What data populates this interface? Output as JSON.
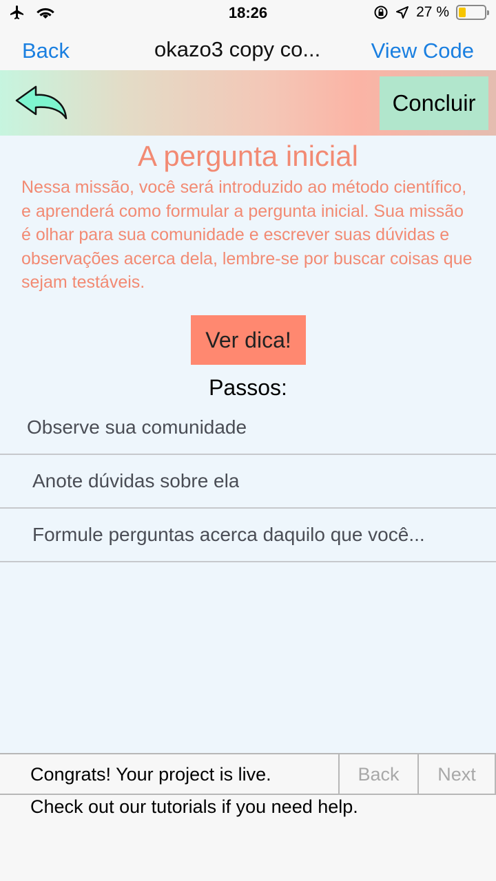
{
  "status_bar": {
    "time": "18:26",
    "battery_percent": "27 %",
    "battery_level": 0.27,
    "icons": [
      "airplane-icon",
      "wifi-icon",
      "rotation-lock-icon",
      "location-icon",
      "battery-icon"
    ]
  },
  "nav": {
    "back_label": "Back",
    "title": "okazo3 copy co...",
    "view_code_label": "View Code"
  },
  "header": {
    "back_icon": "back-arrow-icon",
    "concluir_label": "Concluir"
  },
  "mission": {
    "title": "A pergunta inicial",
    "description": "Nessa missão, você será introduzido ao método científico, e aprenderá como formular a pergunta inicial. Sua missão é olhar para sua comunidade e escrever suas dúvidas e observações acerca dela, lembre-se por buscar coisas que sejam testáveis.",
    "hint_label": "Ver dica!",
    "steps_title": "Passos:",
    "steps": [
      {
        "label": "Observe sua comunidade"
      },
      {
        "label": "Anote dúvidas sobre ela"
      },
      {
        "label": "Formule perguntas acerca daquilo que você..."
      }
    ]
  },
  "tutorial": {
    "congrats": "Congrats! Your project is live.",
    "back_label": "Back",
    "next_label": "Next",
    "help": "Check out our tutorials if you need help."
  },
  "colors": {
    "accent_blue": "#1a7fe0",
    "mission_text": "#f28a73",
    "hint_button": "#ff8870",
    "concluir_button": "#b1e6cc",
    "arrow_fill": "#7ef5cf"
  }
}
